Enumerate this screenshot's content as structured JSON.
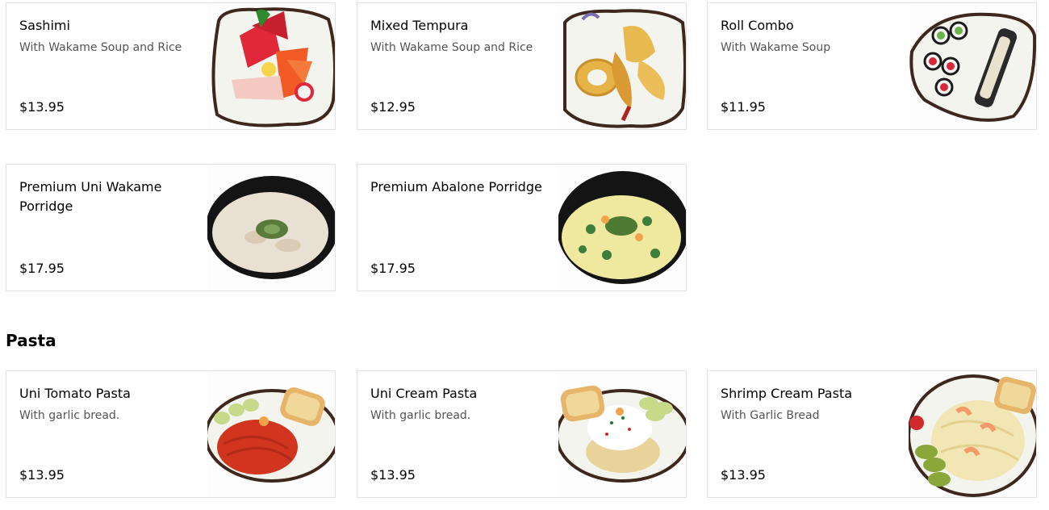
{
  "sections": [
    {
      "title": "",
      "items": [
        {
          "name": "Sashimi",
          "description": "With Wakame Soup and Rice",
          "price": "$13.95",
          "image_icon": "sashimi-plate-image"
        },
        {
          "name": "Mixed Tempura",
          "description": "With Wakame Soup and Rice",
          "price": "$12.95",
          "image_icon": "tempura-plate-image"
        },
        {
          "name": "Roll Combo",
          "description": "With Wakame Soup",
          "price": "$11.95",
          "image_icon": "sushi-roll-plate-image"
        },
        {
          "name": "Premium Uni Wakame Porridge",
          "description": "",
          "price": "$17.95",
          "image_icon": "porridge-bowl-image"
        },
        {
          "name": "Premium Abalone Porridge",
          "description": "",
          "price": "$17.95",
          "image_icon": "abalone-porridge-bowl-image"
        }
      ]
    },
    {
      "title": "Pasta",
      "items": [
        {
          "name": "Uni Tomato Pasta",
          "description": "With garlic bread.",
          "price": "$13.95",
          "image_icon": "tomato-pasta-plate-image"
        },
        {
          "name": "Uni Cream Pasta",
          "description": "With garlic bread.",
          "price": "$13.95",
          "image_icon": "cream-pasta-plate-image"
        },
        {
          "name": "Shrimp Cream Pasta",
          "description": "With Garlic Bread",
          "price": "$13.95",
          "image_icon": "shrimp-pasta-plate-image"
        }
      ]
    }
  ],
  "colors": {
    "card_border": "#e2e2e2",
    "text_primary": "#000000",
    "text_secondary": "#545454",
    "plate_rim": "#4a2f22",
    "bowl_black": "#141414"
  }
}
